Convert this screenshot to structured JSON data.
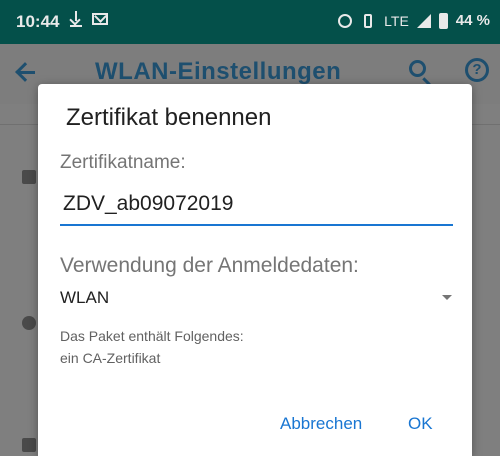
{
  "status_bar": {
    "time": "10:44",
    "network": "LTE",
    "battery": "44 %"
  },
  "app_bar": {
    "title": "WLAN-Einstellungen"
  },
  "dialog": {
    "title": "Zertifikat benennen",
    "name_label": "Zertifikatname:",
    "name_value": "ZDV_ab09072019",
    "usage_label": "Verwendung der Anmeldedaten:",
    "usage_value": "WLAN",
    "info_line1": "Das Paket enthält Folgendes:",
    "info_line2": "ein CA-Zertifikat",
    "cancel_label": "Abbrechen",
    "ok_label": "OK"
  },
  "colors": {
    "status_bar_bg": "#04504a",
    "scrim": "#7f7f7f",
    "accent": "#1976d2",
    "app_bar_text": "#1e4f6f"
  }
}
